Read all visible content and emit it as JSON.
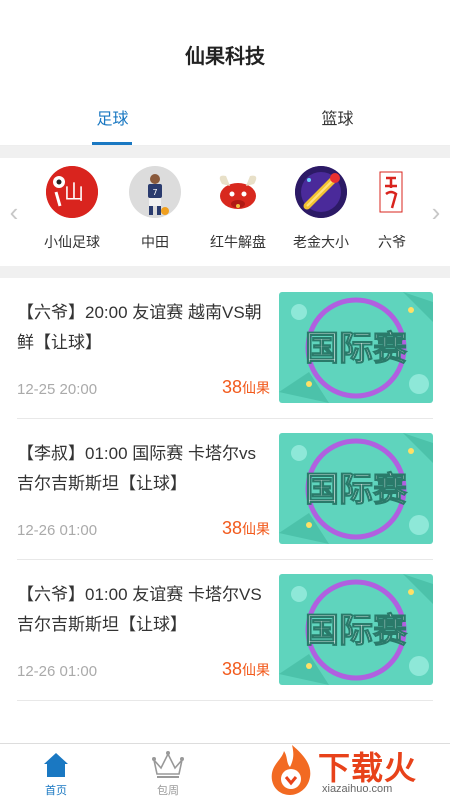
{
  "header": {
    "title": "仙果科技"
  },
  "tabs": [
    {
      "label": "足球",
      "active": true
    },
    {
      "label": "篮球",
      "active": false
    }
  ],
  "experts": [
    {
      "name": "小仙足球",
      "icon": "xiaoxian-avatar"
    },
    {
      "name": "中田",
      "icon": "player-avatar"
    },
    {
      "name": "红牛解盘",
      "icon": "redbull-avatar"
    },
    {
      "name": "老金大小",
      "icon": "laojin-avatar"
    },
    {
      "name": "六爷",
      "icon": "liuye-avatar"
    }
  ],
  "list": [
    {
      "title": "【六爷】20:00 友谊赛 越南VS朝鲜【让球】",
      "date": "12-25 20:00",
      "price": "38",
      "unit": "仙果",
      "thumb_text": "国际赛"
    },
    {
      "title": "【李叔】01:00 国际赛 卡塔尔vs吉尔吉斯斯坦【让球】",
      "date": "12-26 01:00",
      "price": "38",
      "unit": "仙果",
      "thumb_text": "国际赛"
    },
    {
      "title": "【六爷】01:00 友谊赛 卡塔尔VS吉尔吉斯斯坦【让球】",
      "date": "12-26 01:00",
      "price": "38",
      "unit": "仙果",
      "thumb_text": "国际赛"
    }
  ],
  "bottom_nav": [
    {
      "label": "首页",
      "active": true,
      "icon": "home-icon"
    },
    {
      "label": "包周",
      "active": false,
      "icon": "crown-icon"
    }
  ],
  "watermark": {
    "text": "下载火",
    "sub": "xiazaihuo.com"
  },
  "colors": {
    "accent": "#1a78c2",
    "price": "#f25a1c",
    "thumb_bg": "#5fd4bd"
  }
}
